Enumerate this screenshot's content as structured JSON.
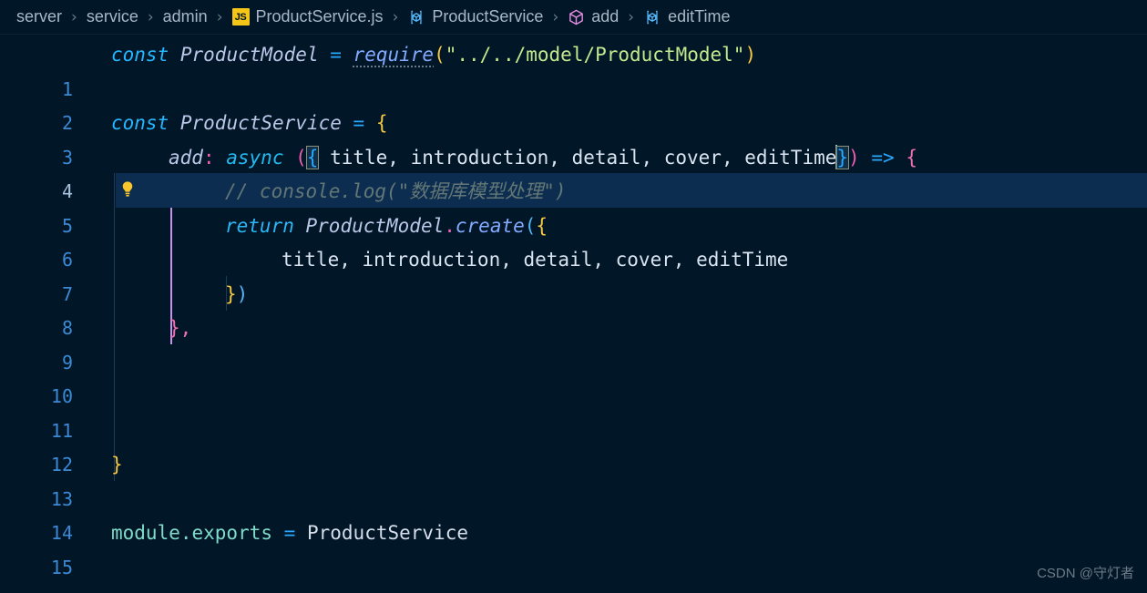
{
  "breadcrumb": {
    "items": [
      {
        "label": "server",
        "icon": ""
      },
      {
        "label": "service",
        "icon": ""
      },
      {
        "label": "admin",
        "icon": ""
      },
      {
        "label": "ProductService.js",
        "icon": "js-file-icon",
        "icon_text": "JS"
      },
      {
        "label": "ProductService",
        "icon": "symbol-variable-icon"
      },
      {
        "label": "add",
        "icon": "symbol-method-cube-icon"
      },
      {
        "label": "editTime",
        "icon": "symbol-variable-icon"
      }
    ],
    "separator": "›"
  },
  "editor": {
    "language": "javascript",
    "file_name": "ProductService.js",
    "active_line": 4,
    "cursor": {
      "line": 4,
      "after_text": "editTime"
    },
    "lightbulb_line": 4,
    "lines": [
      {
        "n": "1",
        "text": "const ProductModel = require(\"../../model/ProductModel\")"
      },
      {
        "n": "2",
        "text": ""
      },
      {
        "n": "3",
        "text": "const ProductService = {"
      },
      {
        "n": "4",
        "text": "    add: async ({ title, introduction, detail, cover, editTime }) => {"
      },
      {
        "n": "5",
        "text": "        // console.log(\"数据库模型处理\")"
      },
      {
        "n": "6",
        "text": "        return ProductModel.create({"
      },
      {
        "n": "7",
        "text": "            title, introduction, detail, cover, editTime"
      },
      {
        "n": "8",
        "text": "        })"
      },
      {
        "n": "9",
        "text": "    },"
      },
      {
        "n": "10",
        "text": ""
      },
      {
        "n": "11",
        "text": ""
      },
      {
        "n": "12",
        "text": ""
      },
      {
        "n": "13",
        "text": "}"
      },
      {
        "n": "14",
        "text": ""
      },
      {
        "n": "15",
        "text": "module.exports = ProductService"
      }
    ],
    "tokens": {
      "l1": {
        "kw": "const",
        "name": "ProductModel",
        "eq": "=",
        "fn": "require",
        "open": "(",
        "str": "\"../../model/ProductModel\"",
        "close": ")"
      },
      "l3": {
        "kw": "const",
        "name": "ProductService",
        "eq": "=",
        "brace": "{"
      },
      "l4": {
        "prop": "add",
        "colon": ":",
        "async": "async",
        "paren": "(",
        "brace_open": "{",
        "params": " title, introduction, detail, cover, editTime",
        "brace_close": "}",
        "paren_close": ")",
        "arrow": "=>",
        "body_brace": "{"
      },
      "l5": {
        "comment": "// console.log(\"数据库模型处理\")"
      },
      "l6": {
        "kw": "return",
        "obj": "ProductModel",
        "dot": ".",
        "method": "create",
        "paren": "(",
        "brace": "{"
      },
      "l7": {
        "params": "title, introduction, detail, cover, editTime"
      },
      "l8": {
        "brace": "}",
        "paren": ")"
      },
      "l9": {
        "brace": "}",
        "comma": ","
      },
      "l13": {
        "brace": "}"
      },
      "l15": {
        "module": "module.exports",
        "eq": "=",
        "name": "ProductService"
      }
    }
  },
  "watermark": {
    "text": "CSDN @守灯者"
  },
  "colors": {
    "background": "#011627",
    "line_number": "#3c89d4",
    "active_line": "#0c2d4f",
    "indent_guide": "#1d3b53",
    "active_indent_guide": "#c792ea",
    "string": "#c3e88d",
    "comment": "#637777",
    "keyword": "#26b7ff",
    "variable": "#82aaff",
    "text": "#d6deeb",
    "cursor": "#80cbc4",
    "js_badge": "#f5c518"
  }
}
